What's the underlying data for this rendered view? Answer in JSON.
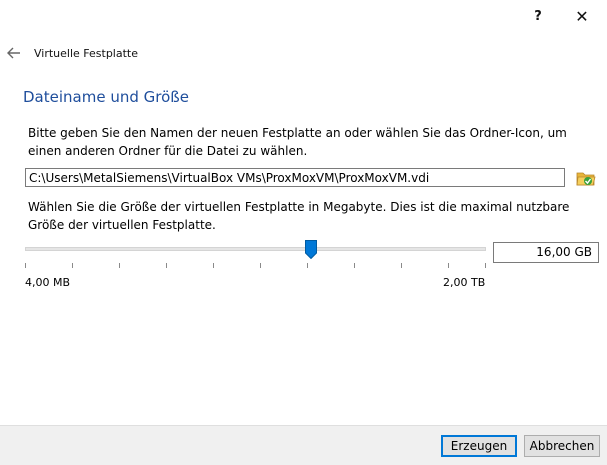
{
  "titlebar": {
    "help_label": "?",
    "close_label": "✕"
  },
  "nav": {
    "back_icon": "arrow-left-icon",
    "title": "Virtuelle Festplatte"
  },
  "section": {
    "title": "Dateiname und Größe"
  },
  "filename": {
    "description": "Bitte geben Sie den Namen der neuen Festplatte an oder wählen Sie das Ordner-Icon, um einen anderen Ordner für die Datei zu wählen.",
    "value": "C:\\Users\\MetalSiemens\\VirtualBox VMs\\ProxMoxVM\\ProxMoxVM.vdi",
    "folder_icon": "folder-icon"
  },
  "size": {
    "description": "Wählen Sie die Größe der virtuellen Festplatte in Megabyte. Dies ist die maximal nutzbare Größe der virtuellen Festplatte.",
    "value": "16,00 GB",
    "min_label": "4,00 MB",
    "max_label": "2,00 TB",
    "slider_fraction": 0.62
  },
  "footer": {
    "create_label": "Erzeugen",
    "cancel_label": "Abbrechen"
  },
  "colors": {
    "accent": "#0078d7",
    "title": "#1f4e9c",
    "footer_bg": "#f0f0f0"
  }
}
